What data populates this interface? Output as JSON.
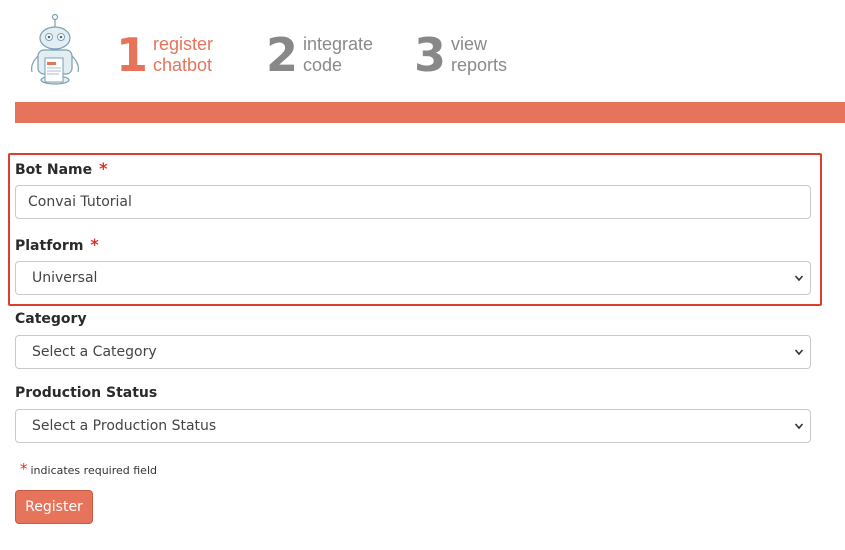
{
  "steps": [
    {
      "number": "1",
      "label_line1": "register",
      "label_line2": "chatbot"
    },
    {
      "number": "2",
      "label_line1": "integrate",
      "label_line2": "code"
    },
    {
      "number": "3",
      "label_line1": "view",
      "label_line2": "reports"
    }
  ],
  "form": {
    "bot_name": {
      "label": "Bot Name",
      "required_mark": "*",
      "value": "Convai Tutorial"
    },
    "platform": {
      "label": "Platform",
      "required_mark": "*",
      "selected": "Universal"
    },
    "category": {
      "label": "Category",
      "selected": "Select a Category"
    },
    "production_status": {
      "label": "Production Status",
      "selected": "Select a Production Status"
    },
    "required_note": {
      "mark": "*",
      "text": "indicates required field"
    },
    "submit_label": "Register"
  },
  "colors": {
    "accent": "#e5745b",
    "required": "#d9312b",
    "highlight_border": "#d9412e",
    "inactive_step": "#888888"
  },
  "icons": {
    "logo": "robot-logo-icon",
    "select_arrow": "chevron-down-icon"
  }
}
